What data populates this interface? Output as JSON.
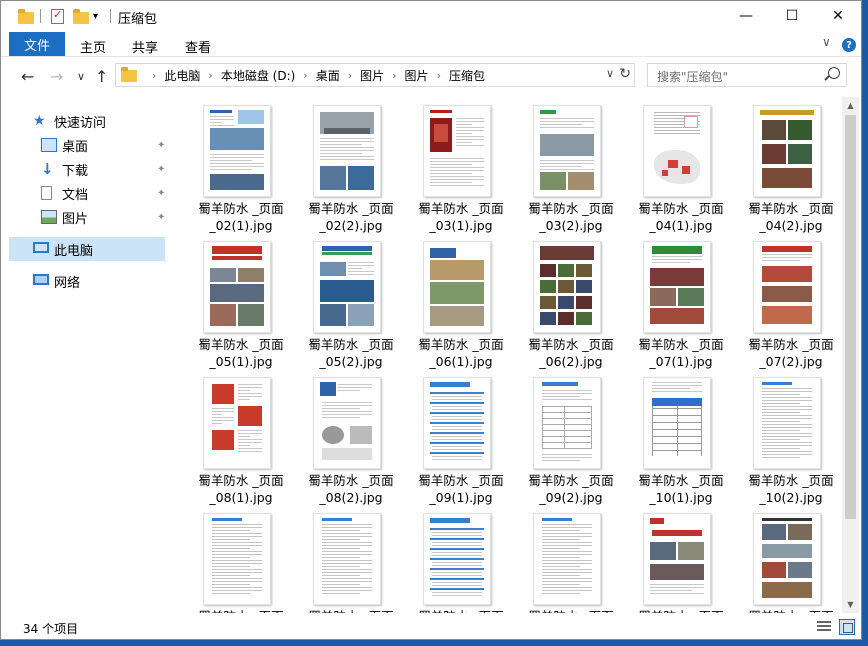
{
  "window": {
    "title": "压缩包",
    "minimize": "—",
    "maximize": "☐",
    "close": "✕"
  },
  "quick_access_toolbar": {
    "dropdown_glyph": "▾"
  },
  "ribbon": {
    "tabs": [
      "文件",
      "主页",
      "共享",
      "查看"
    ],
    "expand_glyph": "∨",
    "help_glyph": "?"
  },
  "navigation": {
    "back": "←",
    "forward": "→",
    "recent": "∨",
    "up": "↑"
  },
  "address": {
    "crumbs": [
      "此电脑",
      "本地磁盘 (D:)",
      "桌面",
      "图片",
      "图片",
      "压缩包"
    ],
    "separator": "›",
    "dropdown_glyph": "∨",
    "refresh_glyph": "↻"
  },
  "search": {
    "placeholder": "搜索\"压缩包\""
  },
  "sidebar": {
    "items": [
      {
        "label": "快速访问",
        "icon": "star-icon",
        "pinned": false
      },
      {
        "label": "桌面",
        "icon": "desktop-icon",
        "pinned": true
      },
      {
        "label": "下载",
        "icon": "download-icon",
        "pinned": true
      },
      {
        "label": "文档",
        "icon": "document-icon",
        "pinned": true
      },
      {
        "label": "图片",
        "icon": "pictures-icon",
        "pinned": true
      },
      {
        "label": "此电脑",
        "icon": "computer-icon",
        "pinned": false,
        "selected": true
      },
      {
        "label": "网络",
        "icon": "network-icon",
        "pinned": false
      }
    ],
    "pin_glyph": "📌"
  },
  "files": [
    {
      "line1": "蜀羊防水 _页面",
      "line2": "_02(1).jpg",
      "style": "report"
    },
    {
      "line1": "蜀羊防水 _页面",
      "line2": "_02(2).jpg",
      "style": "meeting"
    },
    {
      "line1": "蜀羊防水 _页面",
      "line2": "_03(1).jpg",
      "style": "redcert"
    },
    {
      "line1": "蜀羊防水 _页面",
      "line2": "_03(2).jpg",
      "style": "greenbuild"
    },
    {
      "line1": "蜀羊防水 _页面",
      "line2": "_04(1).jpg",
      "style": "map"
    },
    {
      "line1": "蜀羊防水 _页面",
      "line2": "_04(2).jpg",
      "style": "stage"
    },
    {
      "line1": "蜀羊防水 _页面",
      "line2": "_05(1).jpg",
      "style": "redtitle"
    },
    {
      "line1": "蜀羊防水 _页面",
      "line2": "_05(2).jpg",
      "style": "bluephotos"
    },
    {
      "line1": "蜀羊防水 _页面",
      "line2": "_06(1).jpg",
      "style": "aerial"
    },
    {
      "line1": "蜀羊防水 _页面",
      "line2": "_06(2).jpg",
      "style": "grid"
    },
    {
      "line1": "蜀羊防水 _页面",
      "line2": "_07(1).jpg",
      "style": "greenphotos"
    },
    {
      "line1": "蜀羊防水 _页面",
      "line2": "_07(2).jpg",
      "style": "redstage"
    },
    {
      "line1": "蜀羊防水 _页面",
      "line2": "_08(1).jpg",
      "style": "people"
    },
    {
      "line1": "蜀羊防水 _页面",
      "line2": "_08(2).jpg",
      "style": "product"
    },
    {
      "line1": "蜀羊防水 _页面",
      "line2": "_09(1).jpg",
      "style": "bluelist"
    },
    {
      "line1": "蜀羊防水 _页面",
      "line2": "_09(2).jpg",
      "style": "table"
    },
    {
      "line1": "蜀羊防水 _页面",
      "line2": "_10(1).jpg",
      "style": "bluetable"
    },
    {
      "line1": "蜀羊防水 _页面",
      "line2": "_10(2).jpg",
      "style": "text"
    },
    {
      "line1": "蜀羊防水 _页面",
      "line2": "",
      "style": "text"
    },
    {
      "line1": "蜀羊防水 _页面",
      "line2": "",
      "style": "text"
    },
    {
      "line1": "蜀羊防水 _页面",
      "line2": "",
      "style": "bluelist"
    },
    {
      "line1": "蜀羊防水 _页面",
      "line2": "",
      "style": "text"
    },
    {
      "line1": "蜀羊防水 _页面",
      "line2": "",
      "style": "redhead"
    },
    {
      "line1": "蜀羊防水 _页面",
      "line2": "",
      "style": "photostack"
    }
  ],
  "status": {
    "count": "34 个项目"
  },
  "colors": {
    "accent": "#1b6ec2",
    "selection": "#cce4f7",
    "folder": "#f5c445"
  }
}
